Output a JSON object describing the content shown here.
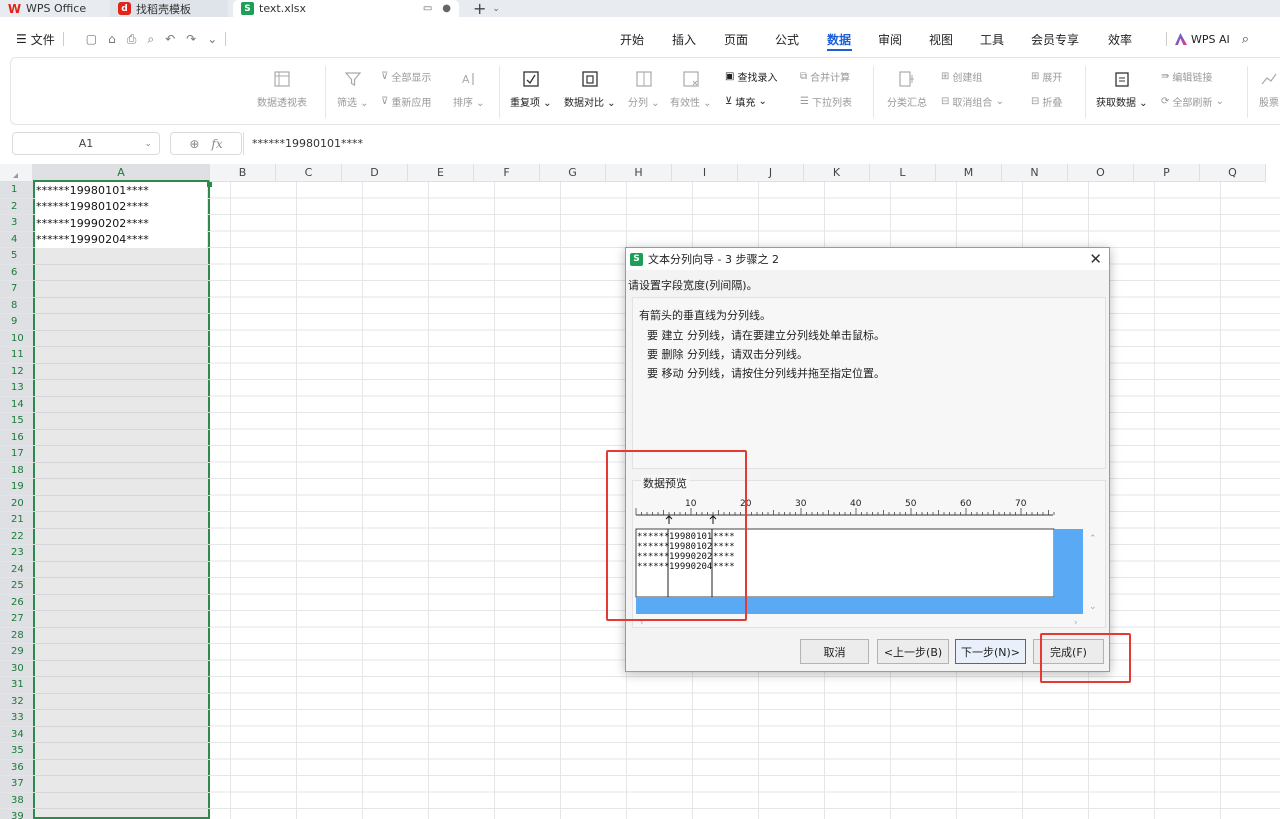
{
  "tabs": {
    "wps": "WPS Office",
    "template": "找稻壳模板",
    "file": "text.xlsx",
    "add": "+",
    "chev": "⌄"
  },
  "menubar": {
    "file": "文件",
    "tabs": [
      "开始",
      "插入",
      "页面",
      "公式",
      "数据",
      "审阅",
      "视图",
      "工具",
      "会员专享",
      "效率"
    ],
    "active_tab": "数据",
    "wps_ai": "WPS AI"
  },
  "ribbon": {
    "pivot": "数据透视表",
    "filter": "筛选",
    "show_all": "全部显示",
    "reapply": "重新应用",
    "sort": "排序",
    "duplicates": "重复项",
    "compare": "数据对比",
    "split": "分列",
    "validity": "有效性",
    "lookup_entry": "查找录入",
    "fill": "填充",
    "consolidate": "合并计算",
    "dropdown_list": "下拉列表",
    "subtotal": "分类汇总",
    "group": "创建组",
    "ungroup": "取消组合",
    "expand": "展开",
    "collapse": "折叠",
    "get_data": "获取数据",
    "edit_links": "编辑链接",
    "refresh_all": "全部刷新",
    "stock": "股票"
  },
  "formula_bar": {
    "name_box": "A1",
    "fx": "fx",
    "value": "******19980101****"
  },
  "sheet": {
    "columns": [
      "A",
      "B",
      "C",
      "D",
      "E",
      "F",
      "G",
      "H",
      "I",
      "J",
      "K",
      "L",
      "M",
      "N",
      "O",
      "P",
      "Q"
    ],
    "rows": [
      "1",
      "2",
      "3",
      "4",
      "5",
      "6",
      "7",
      "8",
      "9",
      "10",
      "11",
      "12",
      "13",
      "14",
      "15",
      "16",
      "17",
      "18",
      "19",
      "20",
      "21",
      "22",
      "23",
      "24",
      "25",
      "26",
      "27",
      "28",
      "29",
      "30",
      "31",
      "32",
      "33",
      "34",
      "35",
      "36",
      "37",
      "38",
      "39"
    ],
    "cells": [
      "******19980101****",
      "******19980102****",
      "******19990202****",
      "******19990204****"
    ]
  },
  "dialog": {
    "icon": "S",
    "title": "文本分列向导 - 3 步骤之 2",
    "subtitle": "请设置字段宽度(列间隔)。",
    "info_lines": [
      "有箭头的垂直线为分列线。",
      "要 建立 分列线，请在要建立分列线处单击鼠标。",
      "要 删除 分列线，请双击分列线。",
      "要 移动 分列线，请按住分列线并拖至指定位置。"
    ],
    "preview_label": "数据预览",
    "ruler_labels": [
      "10",
      "20",
      "30",
      "40",
      "50",
      "60",
      "70"
    ],
    "preview_rows": [
      [
        "******",
        "19980101",
        "****"
      ],
      [
        "******",
        "19980102",
        "****"
      ],
      [
        "******",
        "19990202",
        "****"
      ],
      [
        "******",
        "19990204",
        "****"
      ]
    ],
    "buttons": {
      "cancel": "取消",
      "back": "<上一步(B)",
      "next": "下一步(N)>",
      "finish": "完成(F)"
    }
  },
  "colors": {
    "accent": "#1d5fd6",
    "selection": "#2d8a4a",
    "highlight": "#e53935",
    "preview_bar": "#5aa9f5"
  }
}
